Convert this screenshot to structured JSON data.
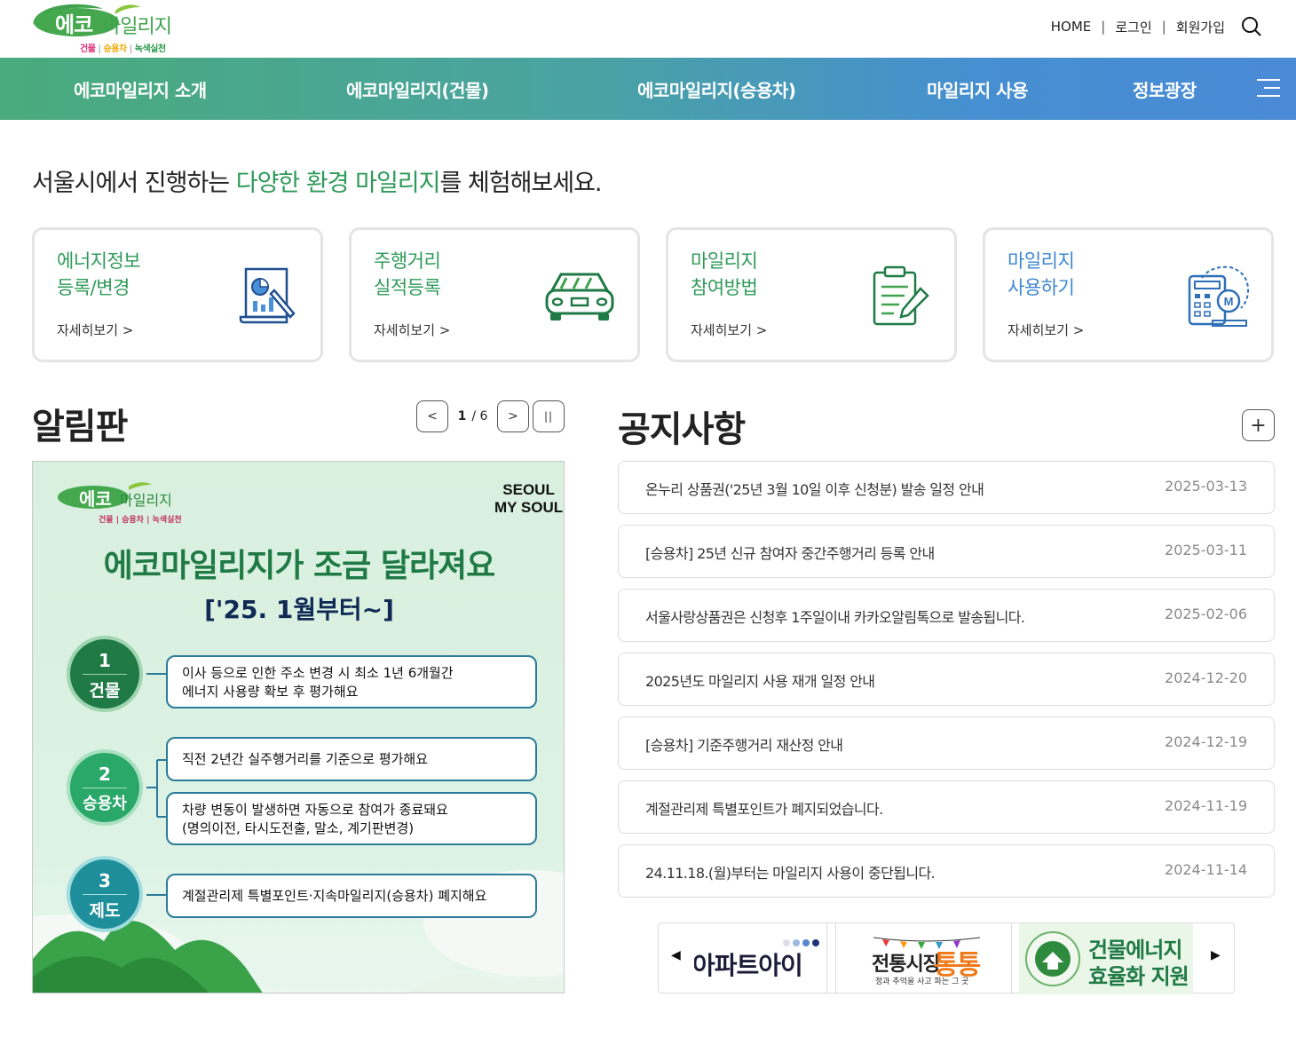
{
  "header": {
    "logo_text": "에코마일리지",
    "logo_sub_1": "건물",
    "logo_sub_2": "승용차",
    "logo_sub_3": "녹색실천",
    "util_links": [
      "HOME",
      "로그인",
      "회원가입"
    ]
  },
  "gnb": {
    "items": [
      "에코마일리지 소개",
      "에코마일리지(건물)",
      "에코마일리지(승용차)",
      "마일리지 사용",
      "정보광장"
    ]
  },
  "intro": {
    "before": "서울시에서 진행하는 ",
    "highlight": "다양한 환경 마일리지",
    "after": "를 체험해보세요."
  },
  "cards": [
    {
      "line1": "에너지정보",
      "line2": "등록/변경",
      "more": "자세히보기 >",
      "icon": "document-chart-icon"
    },
    {
      "line1": "주행거리",
      "line2": "실적등록",
      "more": "자세히보기 >",
      "icon": "car-icon"
    },
    {
      "line1": "마일리지",
      "line2": "참여방법",
      "more": "자세히보기 >",
      "icon": "clipboard-pen-icon"
    },
    {
      "line1": "마일리지",
      "line2": "사용하기",
      "more": "자세히보기 >",
      "icon": "calculator-coin-icon"
    }
  ],
  "board": {
    "title": "알림판",
    "page_current": "1",
    "page_total": "/ 6"
  },
  "banner": {
    "logo_text": "에코마일리지",
    "logo_sub": "건물 | 승용차 | 녹색실천",
    "seoul_line1": "SEOUL",
    "seoul_line2": "MY SOUL",
    "headline": "에코마일리지가 조금 달라져요",
    "subheadline": "['25. 1월부터~]",
    "items": [
      {
        "num": "1",
        "label": "건물",
        "boxes": [
          [
            "이사 등으로 인한 주소 변경 시 최소 1년 6개월간",
            "에너지 사용량 확보 후 평가해요"
          ]
        ]
      },
      {
        "num": "2",
        "label": "승용차",
        "boxes": [
          [
            "직전 2년간 실주행거리를 기준으로 평가해요"
          ],
          [
            "차량 변동이 발생하면 자동으로 참여가 종료돼요",
            "(명의이전, 타시도전출, 말소, 계기판변경)"
          ]
        ]
      },
      {
        "num": "3",
        "label": "제도",
        "boxes": [
          [
            "계절관리제 특별포인트·지속마일리지(승용차) 폐지해요"
          ]
        ]
      }
    ]
  },
  "notices": {
    "title": "공지사항",
    "items": [
      {
        "title": "온누리 상품권('25년 3월 10일 이후 신청분) 발송 일정 안내",
        "date": "2025-03-13"
      },
      {
        "title": "[승용차] 25년 신규 참여자 중간주행거리 등록 안내",
        "date": "2025-03-11"
      },
      {
        "title": "서울사랑상품권은 신청후 1주일이내 카카오알림톡으로 발송됩니다.",
        "date": "2025-02-06"
      },
      {
        "title": "2025년도 마일리지 사용 재개 일정 안내",
        "date": "2024-12-20"
      },
      {
        "title": "[승용차] 기준주행거리 재산정 안내",
        "date": "2024-12-19"
      },
      {
        "title": "계절관리제 특별포인트가 폐지되었습니다.",
        "date": "2024-11-19"
      },
      {
        "title": "24.11.18.(월)부터는 마일리지 사용이 중단됩니다.",
        "date": "2024-11-14"
      }
    ]
  },
  "partners": {
    "items": [
      {
        "name": "아파트아이",
        "text": "아파트아이"
      },
      {
        "name": "전통시장 통통",
        "text1": "전통시장",
        "text2": "통통",
        "caption": "정과 추억을 사고 파는 그 곳"
      },
      {
        "name": "건물에너지 효율화 지원",
        "text1": "건물에너지",
        "text2": "효율화 지원"
      }
    ]
  }
}
